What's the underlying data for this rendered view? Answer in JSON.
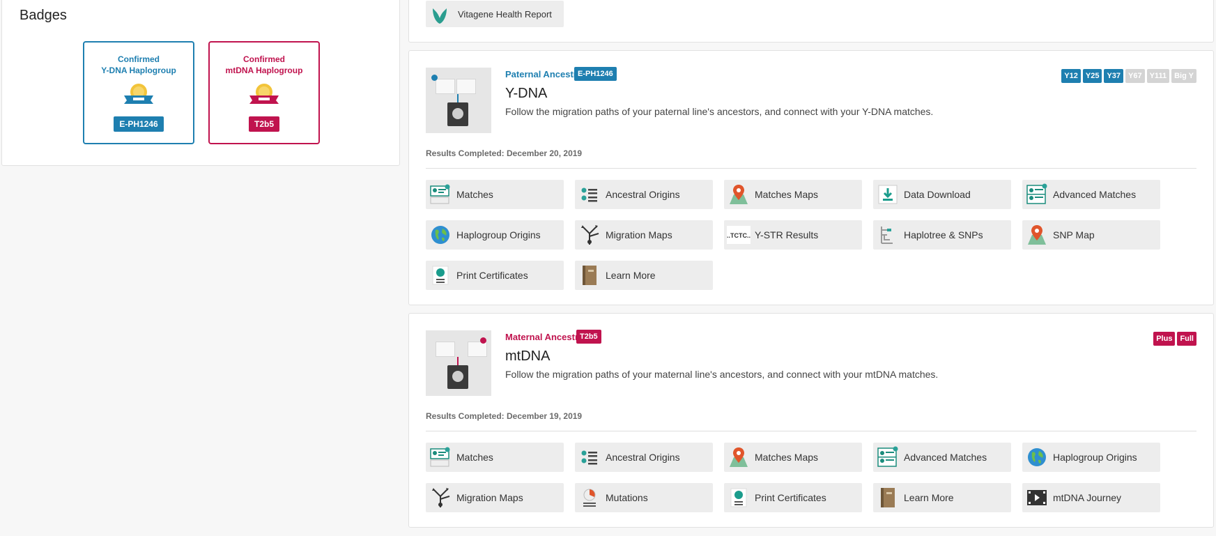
{
  "badges": {
    "title": "Badges",
    "ydna": {
      "line1": "Confirmed",
      "line2": "Y-DNA Haplogroup",
      "value": "E-PH1246",
      "color": "#1e7fb0"
    },
    "mtdna": {
      "line1": "Confirmed",
      "line2": "mtDNA Haplogroup",
      "value": "T2b5",
      "color": "#c0134e"
    }
  },
  "vitagene": {
    "label": "Vitagene Health Report",
    "icon": "vitagene-logo-icon"
  },
  "ydna": {
    "kicker": "Paternal Ancestry",
    "haplogroup": "E-PH1246",
    "title": "Y-DNA",
    "description": "Follow the migration paths of your paternal line's ancestors, and connect with your Y-DNA matches.",
    "results": "Results Completed: December 20, 2019",
    "accent": "#1e7fb0",
    "levels": [
      {
        "label": "Y12",
        "active": true
      },
      {
        "label": "Y25",
        "active": true
      },
      {
        "label": "Y37",
        "active": true
      },
      {
        "label": "Y67",
        "active": false
      },
      {
        "label": "Y111",
        "active": false
      },
      {
        "label": "Big Y",
        "active": false
      }
    ],
    "tools": [
      {
        "label": "Matches",
        "icon": "matches-icon"
      },
      {
        "label": "Ancestral Origins",
        "icon": "ancestral-origins-icon"
      },
      {
        "label": "Matches Maps",
        "icon": "map-pin-icon"
      },
      {
        "label": "Data Download",
        "icon": "download-icon"
      },
      {
        "label": "Advanced Matches",
        "icon": "advanced-matches-icon"
      },
      {
        "label": "Haplogroup Origins",
        "icon": "globe-icon"
      },
      {
        "label": "Migration Maps",
        "icon": "migration-icon"
      },
      {
        "label": "Y-STR Results",
        "icon": "str-sequence-icon",
        "icon_text": "...TCTC..."
      },
      {
        "label": "Haplotree & SNPs",
        "icon": "haplotree-icon"
      },
      {
        "label": "SNP Map",
        "icon": "map-pin-icon"
      },
      {
        "label": "Print Certificates",
        "icon": "certificate-icon"
      },
      {
        "label": "Learn More",
        "icon": "book-icon"
      }
    ]
  },
  "mtdna": {
    "kicker": "Maternal Ancestry",
    "haplogroup": "T2b5",
    "title": "mtDNA",
    "description": "Follow the migration paths of your maternal line's ancestors, and connect with your mtDNA matches.",
    "results": "Results Completed: December 19, 2019",
    "accent": "#c0134e",
    "levels": [
      {
        "label": "Plus",
        "active": true
      },
      {
        "label": "Full",
        "active": true
      }
    ],
    "tools": [
      {
        "label": "Matches",
        "icon": "matches-icon"
      },
      {
        "label": "Ancestral Origins",
        "icon": "ancestral-origins-icon"
      },
      {
        "label": "Matches Maps",
        "icon": "map-pin-icon"
      },
      {
        "label": "Advanced Matches",
        "icon": "advanced-matches-icon"
      },
      {
        "label": "Haplogroup Origins",
        "icon": "globe-icon"
      },
      {
        "label": "Migration Maps",
        "icon": "migration-icon"
      },
      {
        "label": "Mutations",
        "icon": "mutations-icon"
      },
      {
        "label": "Print Certificates",
        "icon": "certificate-icon"
      },
      {
        "label": "Learn More",
        "icon": "book-icon"
      },
      {
        "label": "mtDNA Journey",
        "icon": "video-icon"
      }
    ]
  }
}
